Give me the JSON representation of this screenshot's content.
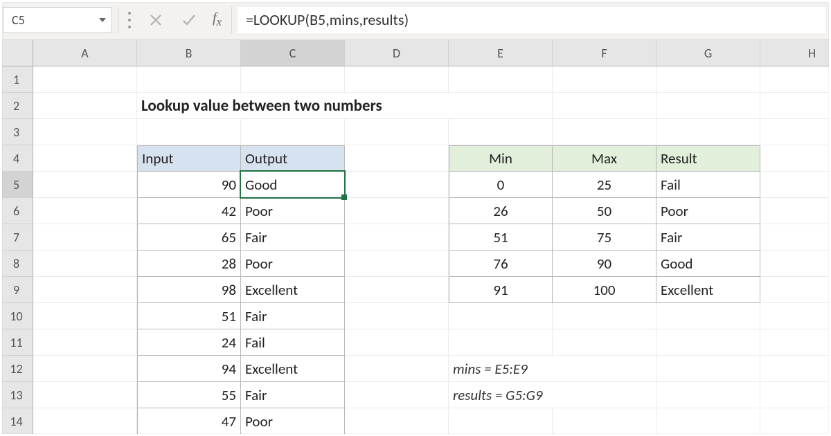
{
  "nameBox": "C5",
  "formula": "=LOOKUP(B5,mins,results)",
  "columns": [
    "A",
    "B",
    "C",
    "D",
    "E",
    "F",
    "G",
    "H"
  ],
  "rows": [
    "1",
    "2",
    "3",
    "4",
    "5",
    "6",
    "7",
    "8",
    "9",
    "10",
    "11",
    "12",
    "13",
    "14"
  ],
  "title": "Lookup value between two numbers",
  "ioHeader": {
    "input": "Input",
    "output": "Output"
  },
  "ioRows": [
    {
      "input": "90",
      "output": "Good"
    },
    {
      "input": "42",
      "output": "Poor"
    },
    {
      "input": "65",
      "output": "Fair"
    },
    {
      "input": "28",
      "output": "Poor"
    },
    {
      "input": "98",
      "output": "Excellent"
    },
    {
      "input": "51",
      "output": "Fair"
    },
    {
      "input": "24",
      "output": "Fail"
    },
    {
      "input": "94",
      "output": "Excellent"
    },
    {
      "input": "55",
      "output": "Fair"
    },
    {
      "input": "47",
      "output": "Poor"
    }
  ],
  "lookupHeader": {
    "min": "Min",
    "max": "Max",
    "result": "Result"
  },
  "lookupRows": [
    {
      "min": "0",
      "max": "25",
      "result": "Fail"
    },
    {
      "min": "26",
      "max": "50",
      "result": "Poor"
    },
    {
      "min": "51",
      "max": "75",
      "result": "Fair"
    },
    {
      "min": "76",
      "max": "90",
      "result": "Good"
    },
    {
      "min": "91",
      "max": "100",
      "result": "Excellent"
    }
  ],
  "notes": {
    "mins": "mins = E5:E9",
    "results": "results = G5:G9"
  },
  "activeCell": {
    "col": "C",
    "row": 5
  }
}
